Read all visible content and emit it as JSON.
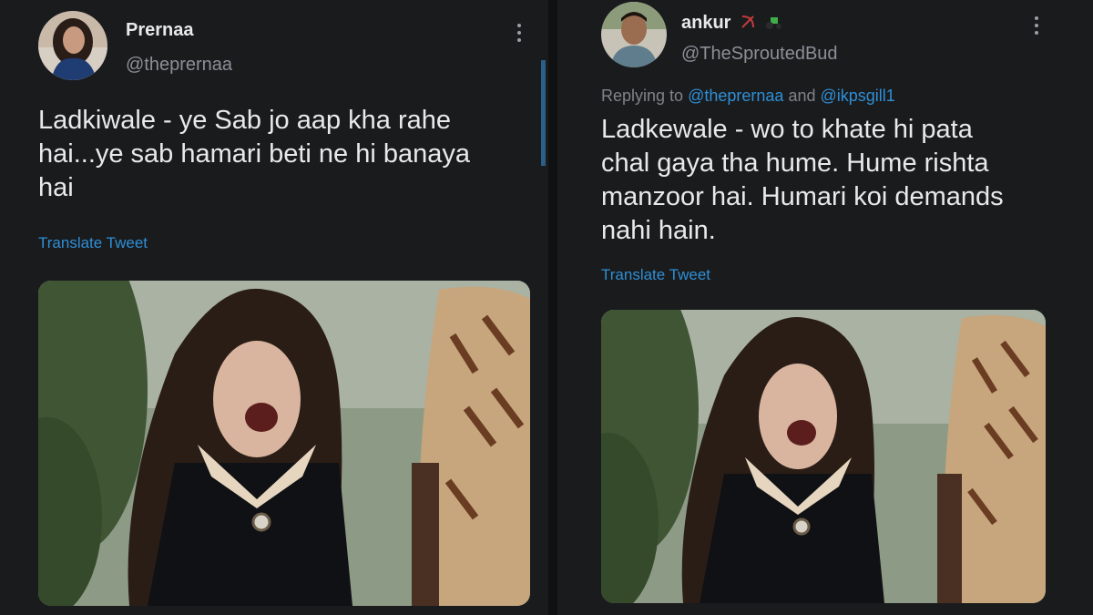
{
  "left_tweet": {
    "display_name": "Prernaa",
    "handle": "@theprernaa",
    "text": "Ladkiwale - ye Sab jo aap kha rahe\nhai...ye sab hamari beti ne hi banaya\nhai",
    "translate_label": "Translate Tweet",
    "avatar_icon": "profile-avatar",
    "media_icon": "meme-photo"
  },
  "right_tweet": {
    "display_name": "ankur",
    "handle": "@TheSproutedBud",
    "replying_prefix": "Replying to",
    "replying_to_1": "@theprernaa",
    "replying_and": "and",
    "replying_to_2": "@ikpsgill1",
    "text": "Ladkewale - wo to khate hi pata\nchal gaya tha hume. Hume rishta\nmanzoor hai. Humari koi demands\nnahi hain.",
    "translate_label": "Translate Tweet",
    "name_emojis": [
      "bow-and-arrow-icon",
      "tractor-icon"
    ],
    "avatar_icon": "profile-avatar",
    "media_icon": "meme-photo"
  },
  "colors": {
    "background": "#17181a",
    "text": "#e7e9ea",
    "secondary": "#8b9096",
    "link": "#2f8fd6"
  }
}
